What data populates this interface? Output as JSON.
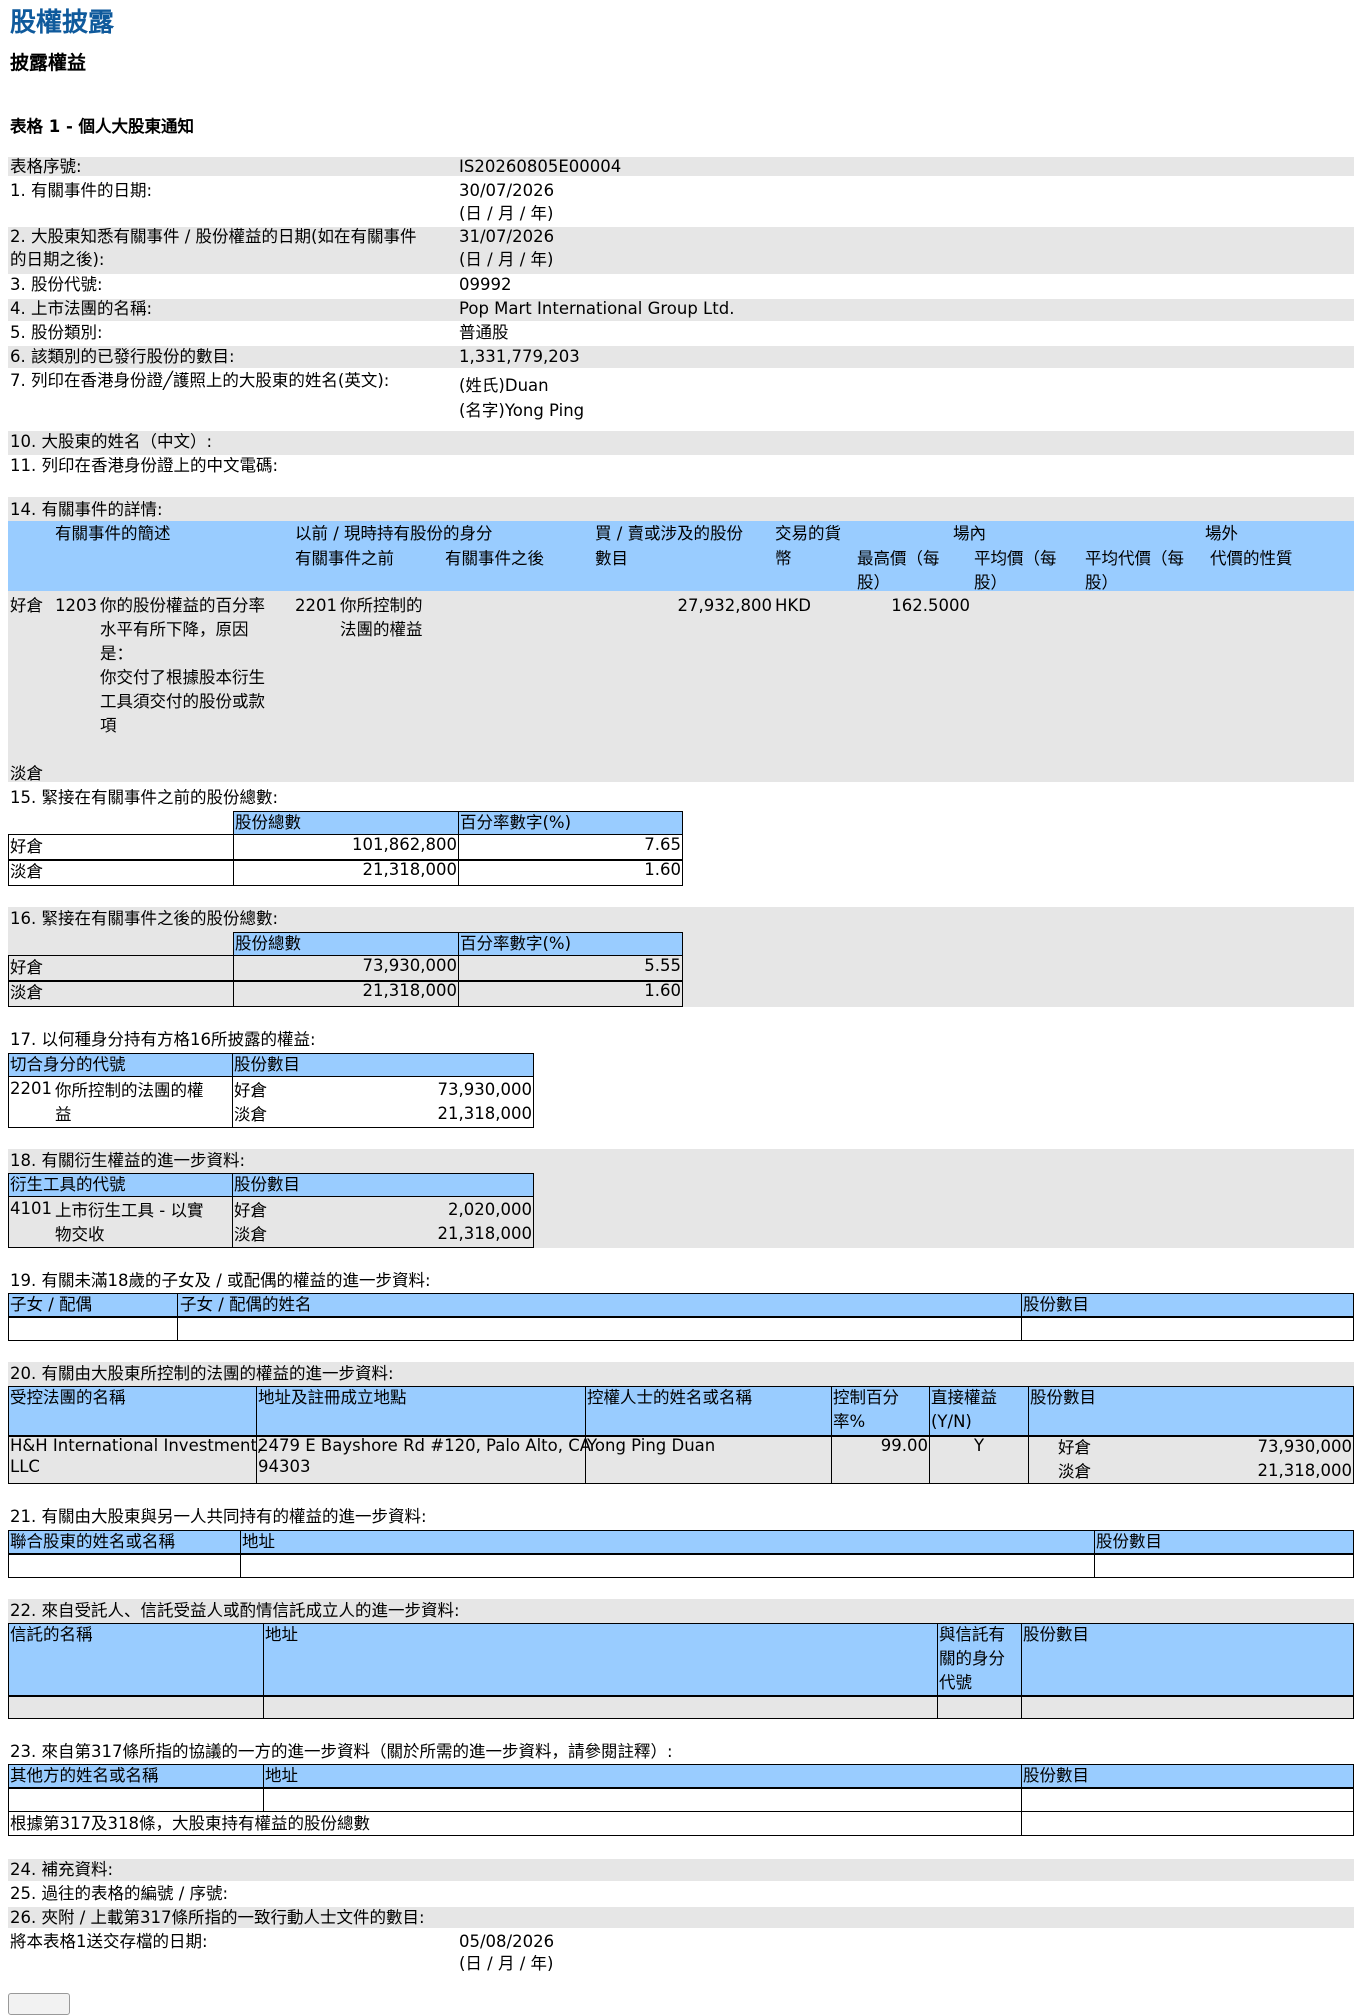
{
  "header": {
    "title": "股權披露",
    "subtitle": "披露權益",
    "form_title": "表格 1 - 個人大股東通知"
  },
  "fields": {
    "serial_label": "表格序號:",
    "serial": "IS20260805E00004",
    "f1_label": "1. 有關事件的日期:",
    "f1_val": "30/07/2026",
    "dmy": "(日 / 月 / 年)",
    "f2_label_a": "2. 大股東知悉有關事件 / 股份權益的日期(如在有關事件",
    "f2_label_b": "的日期之後):",
    "f2_val": "31/07/2026",
    "f3_label": "3. 股份代號:",
    "f3_val": "09992",
    "f4_label": "4. 上市法團的名稱:",
    "f4_val": "Pop Mart International Group Ltd.",
    "f5_label": "5. 股份類別:",
    "f5_val": "普通股",
    "f6_label": "6. 該類別的已發行股份的數目:",
    "f6_val": "1,331,779,203",
    "f7_label": "7. 列印在香港身份證╱護照上的大股東的姓名(英文):",
    "f7_surname": "(姓氏)Duan",
    "f7_given": "(名字)Yong Ping",
    "f10_label": "10. 大股東的姓名（中文）:",
    "f11_label": "11. 列印在香港身份證上的中文電碼:"
  },
  "s14": {
    "title": "14. 有關事件的詳情:",
    "h_desc": "有關事件的簡述",
    "h_cap": "以前 / 現時持有股份的身分",
    "h_before": "有關事件之前",
    "h_after": "有關事件之後",
    "h_shares_a": "買 / 賣或涉及的股份",
    "h_shares_b": "數目",
    "h_cur_a": "交易的貨",
    "h_cur_b": "幣",
    "h_on": "場內",
    "h_high_a": "最高價（每",
    "h_high_b": "股）",
    "h_avg_a": "平均價（每",
    "h_avg_b": "股）",
    "h_off": "場外",
    "h_offavg_a": "平均代價（每",
    "h_offavg_b": "股）",
    "h_nature": "代價的性質",
    "long": "好倉",
    "short": "淡倉",
    "code": "1203",
    "desc": [
      "你的股份權益的百分率",
      "水平有所下降，原因",
      "是：",
      "你交付了根據股本衍生",
      "工具須交付的股份或款",
      "項"
    ],
    "cap_code": "2201",
    "cap": [
      "你所控制的",
      "法團的權益"
    ],
    "shares": "27,932,800",
    "currency": "HKD",
    "high": "162.5000"
  },
  "s15": {
    "title": "15. 緊接在有關事件之前的股份總數:",
    "h1": "股份總數",
    "h2": "百分率數字(%)",
    "rows": [
      {
        "k": "好倉",
        "a": "101,862,800",
        "b": "7.65"
      },
      {
        "k": "淡倉",
        "a": "21,318,000",
        "b": "1.60"
      }
    ]
  },
  "s16": {
    "title": "16. 緊接在有關事件之後的股份總數:",
    "h1": "股份總數",
    "h2": "百分率數字(%)",
    "rows": [
      {
        "k": "好倉",
        "a": "73,930,000",
        "b": "5.55"
      },
      {
        "k": "淡倉",
        "a": "21,318,000",
        "b": "1.60"
      }
    ]
  },
  "s17": {
    "title": "17. 以何種身分持有方格16所披露的權益:",
    "h1": "切合身分的代號",
    "h2": "股份數目",
    "code": "2201",
    "desc_a": "你所控制的法團的權",
    "desc_b": "益",
    "long": "好倉",
    "short": "淡倉",
    "v1": "73,930,000",
    "v2": "21,318,000"
  },
  "s18": {
    "title": "18. 有關衍生權益的進一步資料:",
    "h1": "衍生工具的代號",
    "h2": "股份數目",
    "code": "4101",
    "desc_a": "上市衍生工具 - 以實",
    "desc_b": "物交收",
    "long": "好倉",
    "short": "淡倉",
    "v1": "2,020,000",
    "v2": "21,318,000"
  },
  "s19": {
    "title": "19. 有關未滿18歲的子女及 / 或配偶的權益的進一步資料:",
    "h1": "子女 / 配偶",
    "h2": "子女 / 配偶的姓名",
    "h3": "股份數目"
  },
  "s20": {
    "title": "20. 有關由大股東所控制的法團的權益的進一步資料:",
    "h1": "受控法團的名稱",
    "h2": "地址及註冊成立地點",
    "h3": "控權人士的姓名或名稱",
    "h4a": "控制百分",
    "h4b": "率%",
    "h5a": "直接權益",
    "h5b": "(Y/N)",
    "h6": "股份數目",
    "name_a": "H&H International Investment,",
    "name_b": "LLC",
    "addr_a": "2479 E Bayshore Rd #120, Palo Alto, CA",
    "addr_b": "94303",
    "ctrl": "Yong Ping Duan",
    "pct": "99.00",
    "direct": "Y",
    "long": "好倉",
    "short": "淡倉",
    "v1": "73,930,000",
    "v2": "21,318,000"
  },
  "s21": {
    "title": "21. 有關由大股東與另一人共同持有的權益的進一步資料:",
    "h1": "聯合股東的姓名或名稱",
    "h2": "地址",
    "h3": "股份數目"
  },
  "s22": {
    "title": "22. 來自受託人、信託受益人或酌情信託成立人的進一步資料:",
    "h1": "信託的名稱",
    "h2": "地址",
    "h3a": "與信託有",
    "h3b": "關的身分",
    "h3c": "代號",
    "h4": "股份數目"
  },
  "s23": {
    "title": "23. 來自第317條所指的協議的一方的進一步資料（關於所需的進一步資料，請參閱註釋）:",
    "h1": "其他方的姓名或名稱",
    "h2": "地址",
    "h3": "股份數目",
    "total": "根據第317及318條，大股東持有權益的股份總數"
  },
  "footer": {
    "f24": "24. 補充資料:",
    "f25": "25. 過往的表格的編號 / 序號:",
    "f26": "26. 夾附 / 上載第317條所指的一致行動人士文件的數目:",
    "submit_label": "將本表格1送交存檔的日期:",
    "submit_date": "05/08/2026",
    "dmy": "(日 / 月 / 年)"
  }
}
